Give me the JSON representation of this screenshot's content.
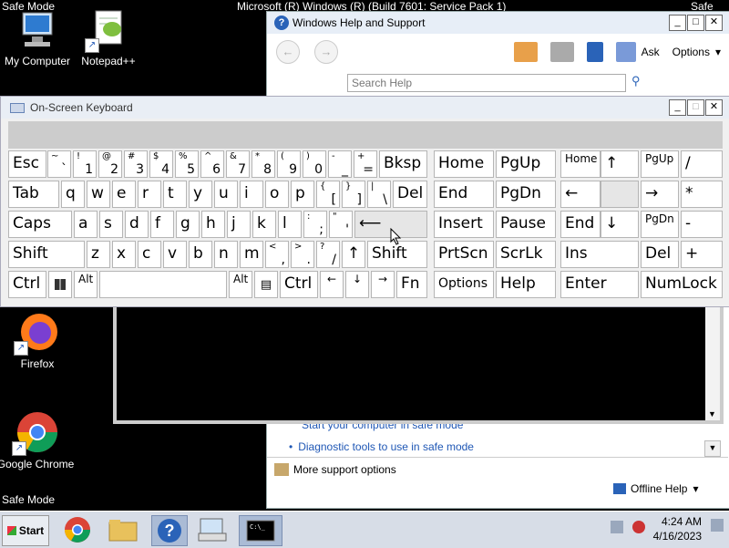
{
  "desktop": {
    "safe_mode_labels": [
      "Safe Mode",
      "Safe Mode"
    ],
    "top_right_fragment": "Safe Mod",
    "title_fragment": "Microsoft (R) Windows (R) (Build 7601: Service Pack 1)",
    "icons": [
      {
        "label": "My Computer"
      },
      {
        "label": "Notepad++"
      },
      {
        "label": "Firefox"
      },
      {
        "label": "Google Chrome"
      }
    ]
  },
  "help_window": {
    "title": "Windows Help and Support",
    "ask_label": "Ask",
    "options_label": "Options",
    "search_placeholder": "Search Help",
    "links": [
      "Start your computer in safe mode",
      "Diagnostic tools to use in safe mode"
    ],
    "more_support": "More support options",
    "offline_help": "Offline Help"
  },
  "osk": {
    "title": "On-Screen Keyboard",
    "row1": [
      "Esc",
      "~",
      "`",
      "!",
      "1",
      "@",
      "2",
      "#",
      "3",
      "$",
      "4",
      "%",
      "5",
      "^",
      "6",
      "&",
      "7",
      "*",
      "8",
      "(",
      "9",
      ")",
      "0",
      "-",
      "_",
      "+",
      "=",
      "Bksp"
    ],
    "labels": {
      "esc": "Esc",
      "bksp": "Bksp",
      "home": "Home",
      "pgup": "PgUp",
      "home_np": "Home",
      "up_np": "↑",
      "pgup_np": "PgUp",
      "slash_np": "/",
      "tab": "Tab",
      "del": "Del",
      "end": "End",
      "pgdn": "PgDn",
      "left_np": "←",
      "right_np": "→",
      "star_np": "*",
      "caps": "Caps",
      "enter_arrow": "⟵",
      "insert": "Insert",
      "pause": "Pause",
      "end_np": "End",
      "down_np": "↓",
      "pgdn_np": "PgDn",
      "minus_np": "-",
      "shift": "Shift",
      "shift2": "Shift",
      "prtscn": "PrtScn",
      "scrlk": "ScrLk",
      "ins_np": "Ins",
      "del_np": "Del",
      "plus_np": "+",
      "ctrl": "Ctrl",
      "alt": "Alt",
      "alt2": "Alt",
      "ctrl2": "Ctrl",
      "left": "←",
      "down": "↓",
      "right": "→",
      "up": "↑",
      "fn": "Fn",
      "options": "Options",
      "help": "Help",
      "enter_np": "Enter",
      "numlock": "NumLock"
    },
    "letters_row2": [
      "q",
      "w",
      "e",
      "r",
      "t",
      "y",
      "u",
      "i",
      "o",
      "p"
    ],
    "letters_row3": [
      "a",
      "s",
      "d",
      "f",
      "g",
      "h",
      "j",
      "k",
      "l"
    ],
    "letters_row4": [
      "z",
      "x",
      "c",
      "v",
      "b",
      "n",
      "m"
    ],
    "sym": {
      "lbrace": "{",
      "lbracket": "[",
      "rbrace": "}",
      "rbracket": "]",
      "pipe": "|",
      "backslash": "\\",
      "colon": ":",
      "semicolon": ";",
      "quote": "\"",
      "apos": "'",
      "lt": "<",
      "comma": ",",
      "gt": ">",
      "period": ".",
      "question": "?",
      "fslash": "/"
    }
  },
  "taskbar": {
    "start_label": "Start",
    "time": "4:24 AM",
    "date": "4/16/2023"
  }
}
